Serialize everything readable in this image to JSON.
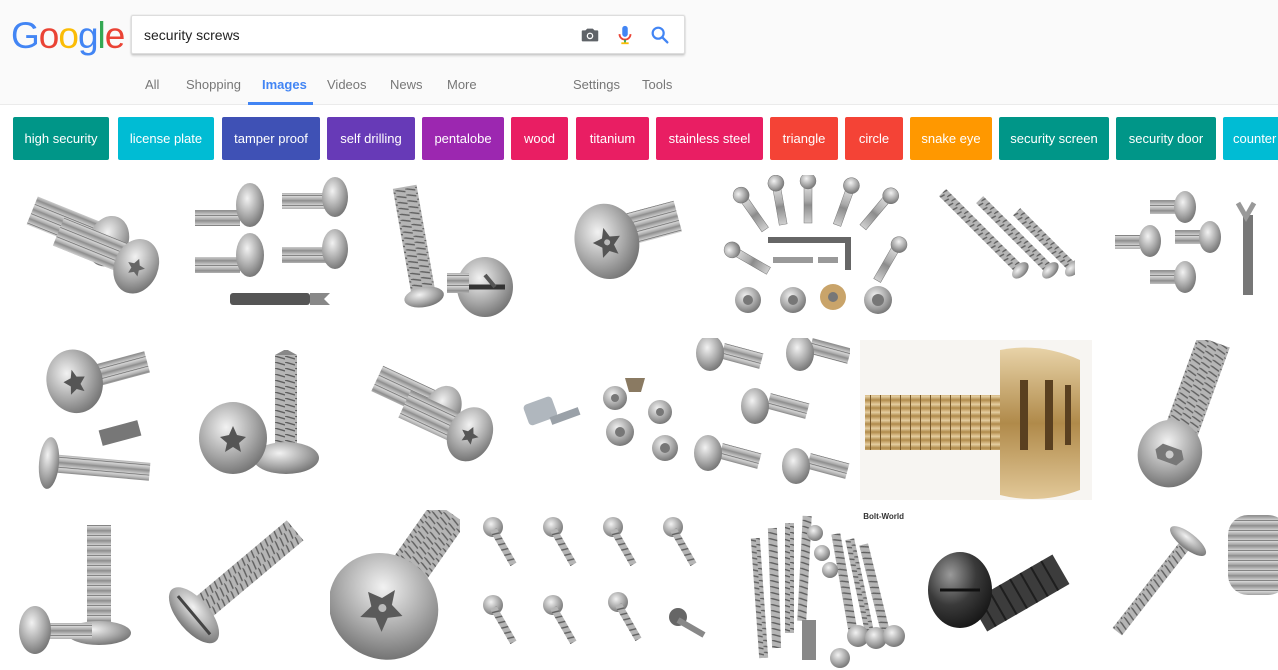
{
  "logo": {
    "letters": [
      "G",
      "o",
      "o",
      "g",
      "l",
      "e"
    ],
    "colors": [
      "#4285f4",
      "#ea4335",
      "#fbbc05",
      "#4285f4",
      "#34a853",
      "#ea4335"
    ]
  },
  "search": {
    "value": "security screws",
    "camera_icon": "camera-icon",
    "mic_icon": "mic-icon",
    "search_icon": "search-icon"
  },
  "nav": {
    "all": "All",
    "shopping": "Shopping",
    "images": "Images",
    "videos": "Videos",
    "news": "News",
    "more": "More",
    "settings": "Settings",
    "tools": "Tools"
  },
  "chips": [
    {
      "label": "high security",
      "color": "#009688"
    },
    {
      "label": "license plate",
      "color": "#00bcd4"
    },
    {
      "label": "tamper proof",
      "color": "#3f51b5"
    },
    {
      "label": "self drilling",
      "color": "#673ab7"
    },
    {
      "label": "pentalobe",
      "color": "#9c27b0"
    },
    {
      "label": "wood",
      "color": "#e91e63"
    },
    {
      "label": "titanium",
      "color": "#e91e63"
    },
    {
      "label": "stainless steel",
      "color": "#e91e63"
    },
    {
      "label": "triangle",
      "color": "#f44336"
    },
    {
      "label": "circle",
      "color": "#f44336"
    },
    {
      "label": "snake eye",
      "color": "#ff9800"
    },
    {
      "label": "security screen",
      "color": "#009688"
    },
    {
      "label": "security door",
      "color": "#009688"
    },
    {
      "label": "counter",
      "color": "#00bcd4"
    }
  ],
  "image_results": [
    {
      "name": "image-result-button-head-pin-torx-pair"
    },
    {
      "name": "image-result-pin-head-screws-set"
    },
    {
      "name": "image-result-one-way-slotted-screws"
    },
    {
      "name": "image-result-button-head-pin-torx"
    },
    {
      "name": "image-result-security-kit-with-tools"
    },
    {
      "name": "image-result-countersunk-screws-three"
    },
    {
      "name": "image-result-pin-head-screws-with-bit"
    },
    {
      "name": "image-result-pin-torx-tapping-screws-with-bit"
    },
    {
      "name": "image-result-self-drilling-pin-torx"
    },
    {
      "name": "image-result-button-head-pin-torx-pair-2"
    },
    {
      "name": "image-result-security-nuts-with-key"
    },
    {
      "name": "image-result-pin-torx-tapping-screws-set"
    },
    {
      "name": "image-result-brass-tamper-bolt"
    },
    {
      "name": "image-result-pin-hex-countersunk"
    },
    {
      "name": "image-result-one-way-machine-screws"
    },
    {
      "name": "image-result-oval-head-slotted-tapping"
    },
    {
      "name": "image-result-button-head-pin-torx-large"
    },
    {
      "name": "image-result-pan-head-tapping-set"
    },
    {
      "name": "image-result-bolt-world-assortment",
      "watermark": "Bolt-World"
    },
    {
      "name": "image-result-black-button-head-bolt"
    },
    {
      "name": "image-result-countersunk-tapping-screw"
    },
    {
      "name": "image-result-partial-screw"
    }
  ]
}
